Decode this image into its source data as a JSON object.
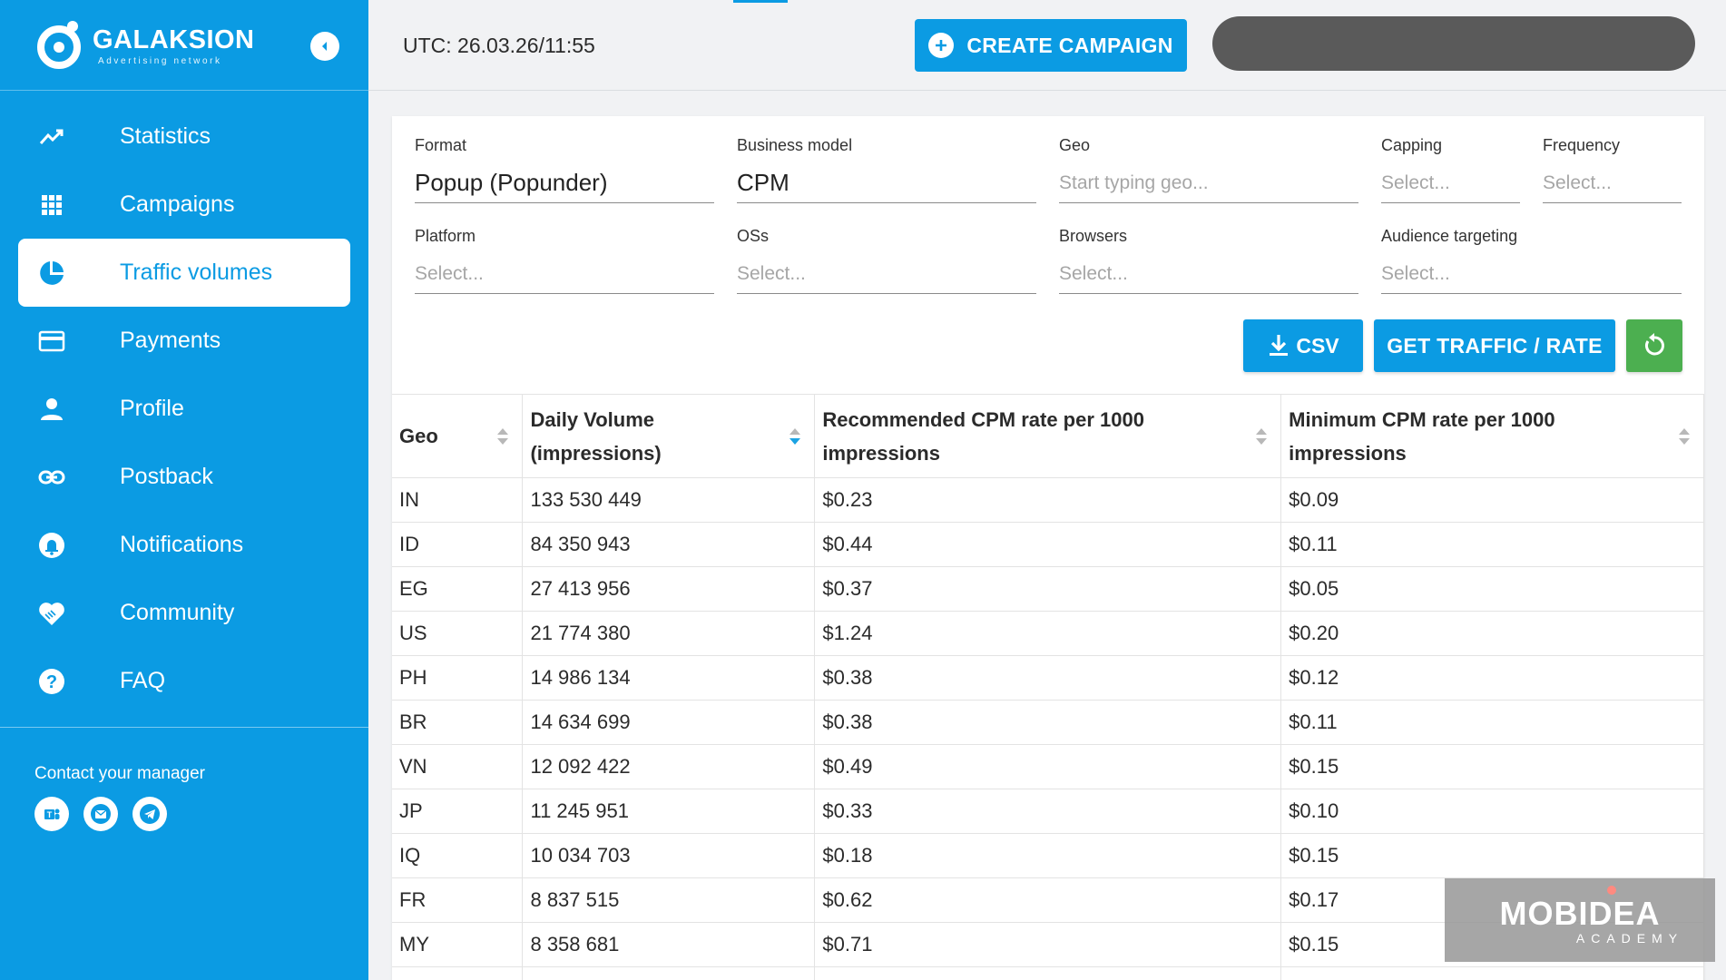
{
  "brand": {
    "name": "GALAKSION",
    "tagline": "Advertising network"
  },
  "sidebar": {
    "items": [
      {
        "label": "Statistics",
        "icon": "trending-up-icon"
      },
      {
        "label": "Campaigns",
        "icon": "grid-icon"
      },
      {
        "label": "Traffic volumes",
        "icon": "pie-chart-icon",
        "active": true
      },
      {
        "label": "Payments",
        "icon": "credit-card-icon"
      },
      {
        "label": "Profile",
        "icon": "person-icon"
      },
      {
        "label": "Postback",
        "icon": "link-icon"
      },
      {
        "label": "Notifications",
        "icon": "bell-icon"
      },
      {
        "label": "Community",
        "icon": "handshake-heart-icon"
      },
      {
        "label": "FAQ",
        "icon": "question-icon"
      }
    ],
    "contact_label": "Contact your manager",
    "contact_icons": [
      "teams-icon",
      "email-icon",
      "telegram-icon"
    ]
  },
  "topbar": {
    "utc": "UTC: 26.03.26/11:55",
    "create_label": "CREATE CAMPAIGN"
  },
  "filters": {
    "format": {
      "label": "Format",
      "value": "Popup (Popunder)"
    },
    "business_model": {
      "label": "Business model",
      "value": "CPM"
    },
    "geo": {
      "label": "Geo",
      "placeholder": "Start typing geo..."
    },
    "capping": {
      "label": "Capping",
      "placeholder": "Select..."
    },
    "frequency": {
      "label": "Frequency",
      "placeholder": "Select..."
    },
    "platform": {
      "label": "Platform",
      "placeholder": "Select..."
    },
    "oss": {
      "label": "OSs",
      "placeholder": "Select..."
    },
    "browsers": {
      "label": "Browsers",
      "placeholder": "Select..."
    },
    "audience": {
      "label": "Audience targeting",
      "placeholder": "Select..."
    }
  },
  "actions": {
    "csv_label": "CSV",
    "get_label": "GET TRAFFIC / RATE"
  },
  "table": {
    "columns": [
      "Geo",
      "Daily Volume (impressions)",
      "Recommended CPM rate per 1000 impressions",
      "Minimum CPM rate per 1000 impressions"
    ],
    "rows": [
      [
        "IN",
        "133 530 449",
        "$0.23",
        "$0.09"
      ],
      [
        "ID",
        "84 350 943",
        "$0.44",
        "$0.11"
      ],
      [
        "EG",
        "27 413 956",
        "$0.37",
        "$0.05"
      ],
      [
        "US",
        "21 774 380",
        "$1.24",
        "$0.20"
      ],
      [
        "PH",
        "14 986 134",
        "$0.38",
        "$0.12"
      ],
      [
        "BR",
        "14 634 699",
        "$0.38",
        "$0.11"
      ],
      [
        "VN",
        "12 092 422",
        "$0.49",
        "$0.15"
      ],
      [
        "JP",
        "11 245 951",
        "$0.33",
        "$0.10"
      ],
      [
        "IQ",
        "10 034 703",
        "$0.18",
        "$0.15"
      ],
      [
        "FR",
        "8 837 515",
        "$0.62",
        "$0.17"
      ],
      [
        "MY",
        "8 358 681",
        "$0.71",
        "$0.15"
      ]
    ]
  },
  "watermark": {
    "main": "MOBIDEA",
    "sub": "ACADEMY"
  },
  "colors": {
    "brand_blue": "#0b9be3",
    "reset_green": "#4caf50",
    "account_pill": "#5a5a5a"
  }
}
